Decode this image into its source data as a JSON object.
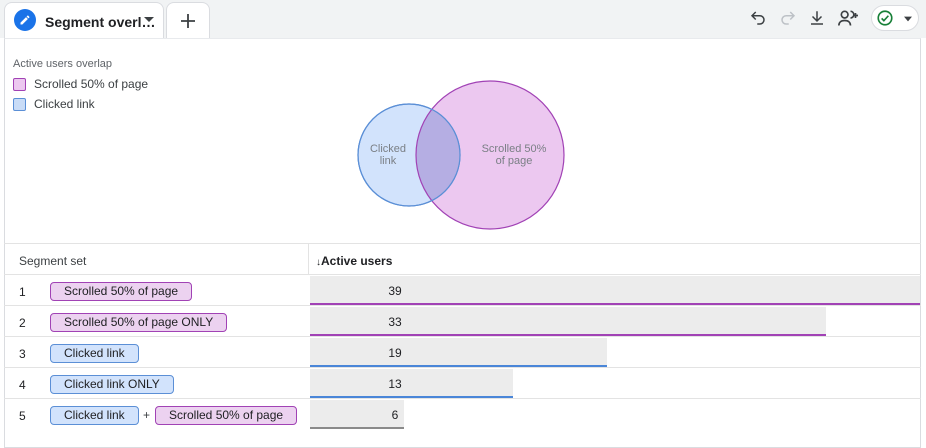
{
  "tab": {
    "title": "Segment overl…"
  },
  "toolbar": {
    "undo_icon": "undo-icon",
    "redo_icon": "redo-icon",
    "download_icon": "download-icon",
    "share_icon": "share-user-icon",
    "status_icon": "check-circle-icon",
    "accent": "#1a73e8",
    "status_color": "#188038"
  },
  "visualization": {
    "title": "Active users overlap",
    "legend": [
      {
        "label": "Scrolled 50% of page",
        "fill": "#ecc8f0",
        "stroke": "#a142b5"
      },
      {
        "label": "Clicked link",
        "fill": "#c9dcf7",
        "stroke": "#5b8fd6"
      }
    ],
    "venn": {
      "circle_a_label_line1": "Scrolled 50%",
      "circle_a_label_line2": "of page",
      "circle_b_label_line1": "Clicked",
      "circle_b_label_line2": "link"
    }
  },
  "table": {
    "col_segment": "Segment set",
    "col_metric_arrow": "↓",
    "col_metric": "Active users",
    "plus": "+",
    "rows": [
      {
        "num": "1",
        "chips": [
          "Scrolled 50% of page"
        ],
        "value": 39,
        "color": "#a142b5"
      },
      {
        "num": "2",
        "chips": [
          "Scrolled 50% of page ONLY"
        ],
        "value": 33,
        "color": "#a142b5"
      },
      {
        "num": "3",
        "chips": [
          "Clicked link"
        ],
        "value": 19,
        "color": "#4a86d8"
      },
      {
        "num": "4",
        "chips": [
          "Clicked link ONLY"
        ],
        "value": 13,
        "color": "#4a86d8"
      },
      {
        "num": "5",
        "chips": [
          "Clicked link",
          "Scrolled 50% of page"
        ],
        "value": 6,
        "color": "#8a8a8a"
      }
    ],
    "max_value": 39
  }
}
